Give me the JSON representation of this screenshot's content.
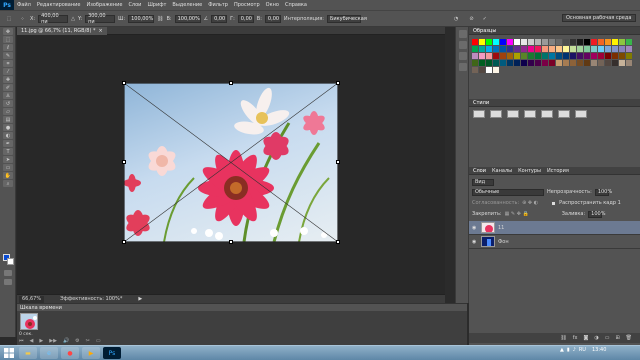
{
  "app": {
    "logo": "Ps"
  },
  "menu": [
    "Файл",
    "Редактирование",
    "Изображение",
    "Слои",
    "Шрифт",
    "Выделение",
    "Фильтр",
    "Просмотр",
    "Окно",
    "Справка"
  ],
  "options": {
    "x_label": "X:",
    "x_value": "400,00 пи",
    "y_label": "Y:",
    "y_value": "300,00 пи",
    "w_label": "Ш:",
    "w_value": "100,00%",
    "h_label": "В:",
    "h_value": "100,00%",
    "angle_value": "0,00",
    "h_skew_label": "Г:",
    "h_skew_value": "0,00",
    "v_skew_label": "В:",
    "v_skew_value": "0,00",
    "interp_label": "Интерполяция:",
    "interp_value": "Бикубическая",
    "workspace": "Основная рабочая среда"
  },
  "document": {
    "tab_title": "11.jpg @ 66,7% (11, RGB/8) *",
    "close": "×"
  },
  "status": {
    "zoom": "66,67%",
    "info": "Эффективность: 100%*",
    "arrow": "▶"
  },
  "timeline": {
    "title": "Шкала времени",
    "clip_label": "0 сек.",
    "controls": [
      "⏮",
      "◀",
      "▶",
      "▶▶",
      "🔊",
      "⚙",
      "✂",
      "▭"
    ]
  },
  "panels": {
    "swatches": {
      "title": "Образцы",
      "colors": [
        "#ff0000",
        "#ffff00",
        "#00ff00",
        "#00ffff",
        "#0000ff",
        "#ff00ff",
        "#ffffff",
        "#e6e6e6",
        "#cccccc",
        "#b3b3b3",
        "#999999",
        "#808080",
        "#666666",
        "#4d4d4d",
        "#333333",
        "#1a1a1a",
        "#000000",
        "#ed1c24",
        "#f26522",
        "#f7941d",
        "#fff200",
        "#8dc63f",
        "#39b54a",
        "#00a651",
        "#00a99d",
        "#00aeef",
        "#0072bc",
        "#0054a6",
        "#2e3192",
        "#662d91",
        "#92278f",
        "#ec008c",
        "#ed145b",
        "#f69679",
        "#f9ad81",
        "#fdc689",
        "#fff799",
        "#c4df9b",
        "#a3d39c",
        "#82ca9d",
        "#7accc8",
        "#6dcff6",
        "#7da7d9",
        "#8393ca",
        "#8781bd",
        "#a186be",
        "#bd8cbf",
        "#f49ac1",
        "#f5989d",
        "#9e0b0f",
        "#a0410d",
        "#a36209",
        "#aba000",
        "#598527",
        "#1a7b30",
        "#007236",
        "#00746b",
        "#0076a3",
        "#004b80",
        "#003471",
        "#1b1464",
        "#440e62",
        "#630460",
        "#9e005d",
        "#9e0039",
        "#790000",
        "#7b2e00",
        "#7d4900",
        "#827b00",
        "#406618",
        "#005e20",
        "#005826",
        "#005952",
        "#005b7f",
        "#003663",
        "#002157",
        "#0d004c",
        "#32004b",
        "#4b0049",
        "#7b0046",
        "#7a0026",
        "#c69c6d",
        "#a67c52",
        "#8c6239",
        "#754c24",
        "#603913",
        "#998675",
        "#736357",
        "#534741",
        "#362f2d",
        "#c7b299",
        "#998675",
        "#736357",
        "#534741",
        "#ffffff",
        "#fdf5e6"
      ]
    },
    "styles": {
      "title": "Стили"
    },
    "layers": {
      "tabs": [
        "Слои",
        "Каналы",
        "Контуры",
        "История"
      ],
      "filter_kind": "Вид",
      "blend_mode": "Обычные",
      "opacity_label": "Непрозрачность:",
      "opacity_value": "100%",
      "lock_label": "Закрепить:",
      "fill_label": "Заливка:",
      "fill_value": "100%",
      "consistency_label": "Согласованность:",
      "propagate_label": "Распространить кадр 1",
      "layer_items": [
        {
          "name": "11"
        },
        {
          "name": "Фон"
        }
      ]
    }
  },
  "taskbar": {
    "time": "13:40",
    "lang": "RU"
  }
}
